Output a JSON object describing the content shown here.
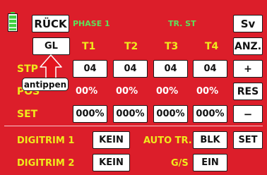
{
  "header": {
    "back_label": "RÜCK",
    "phase_label": "PHASE 1",
    "mode_label": "TR. ST",
    "save_label": "Sv"
  },
  "columns": {
    "gl_label": "GL",
    "t1": "T1",
    "t2": "T2",
    "t3": "T3",
    "t4": "T4",
    "anz_label": "ANZ."
  },
  "rows": {
    "step": {
      "label": "STP",
      "values": [
        "04",
        "04",
        "04",
        "04"
      ]
    },
    "pos": {
      "label": "POS",
      "values": [
        "00%",
        "00%",
        "00%",
        "00%"
      ]
    },
    "set": {
      "label": "SET",
      "values": [
        "000%",
        "000%",
        "000%",
        "000%"
      ]
    }
  },
  "side_buttons": {
    "plus": "+",
    "res": "RES",
    "minus": "−",
    "set": "SET"
  },
  "bottom": {
    "digitrim1_label": "DIGITRIM 1",
    "digitrim1_value": "KEIN",
    "autotr_label": "AUTO TR.",
    "autotr_value": "BLK",
    "digitrim2_label": "DIGITRIM 2",
    "digitrim2_value": "KEIN",
    "gs_label": "G/S",
    "gs_value": "EIN"
  },
  "annotation": {
    "callout_text": "antippen"
  },
  "colors": {
    "background": "#dc1e2a",
    "label_yellow": "#f0ea1c",
    "label_green": "#5ee05a",
    "battery_green": "#3fcf3f"
  }
}
